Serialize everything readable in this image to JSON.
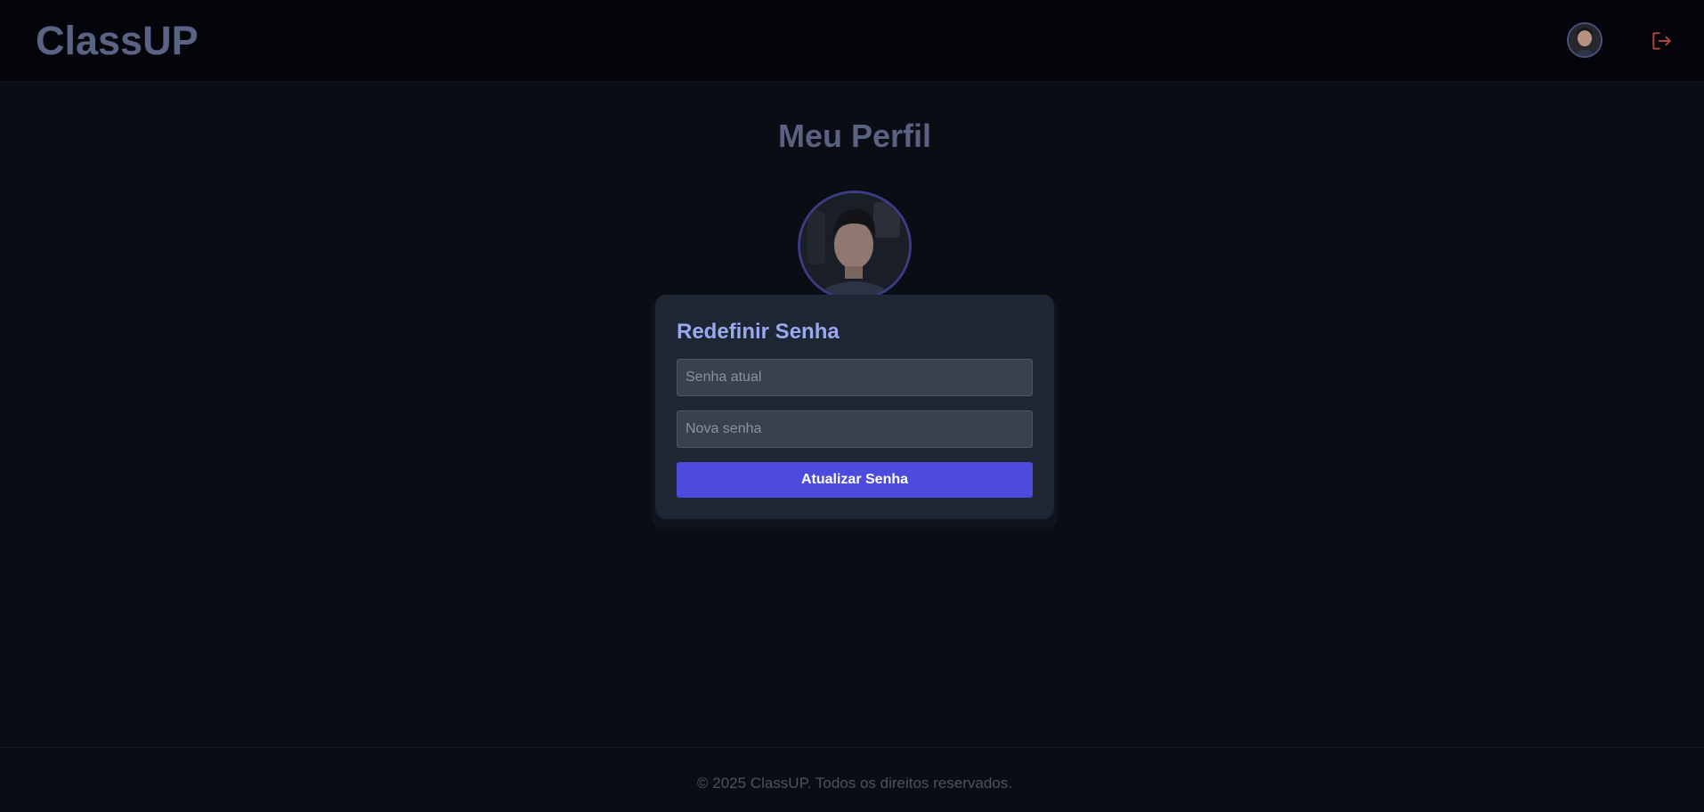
{
  "header": {
    "logo": "ClassUP",
    "avatar_icon": "user-avatar",
    "logout_icon": "logout-icon"
  },
  "profile": {
    "title": "Meu Perfil",
    "photo_icon": "profile-photo"
  },
  "password_card": {
    "title": "Redefinir Senha",
    "current_password_placeholder": "Senha atual",
    "new_password_placeholder": "Nova senha",
    "current_password_value": "",
    "new_password_value": "",
    "submit_label": "Atualizar Senha"
  },
  "footer": {
    "text": "© 2025 ClassUP. Todos os direitos reservados."
  },
  "colors": {
    "background": "#0a0d14",
    "header_bg": "#03050b",
    "card_bg": "#1e2533",
    "accent": "#4d4bdd",
    "card_title": "#9aa8f0",
    "logout": "#b0443f"
  }
}
